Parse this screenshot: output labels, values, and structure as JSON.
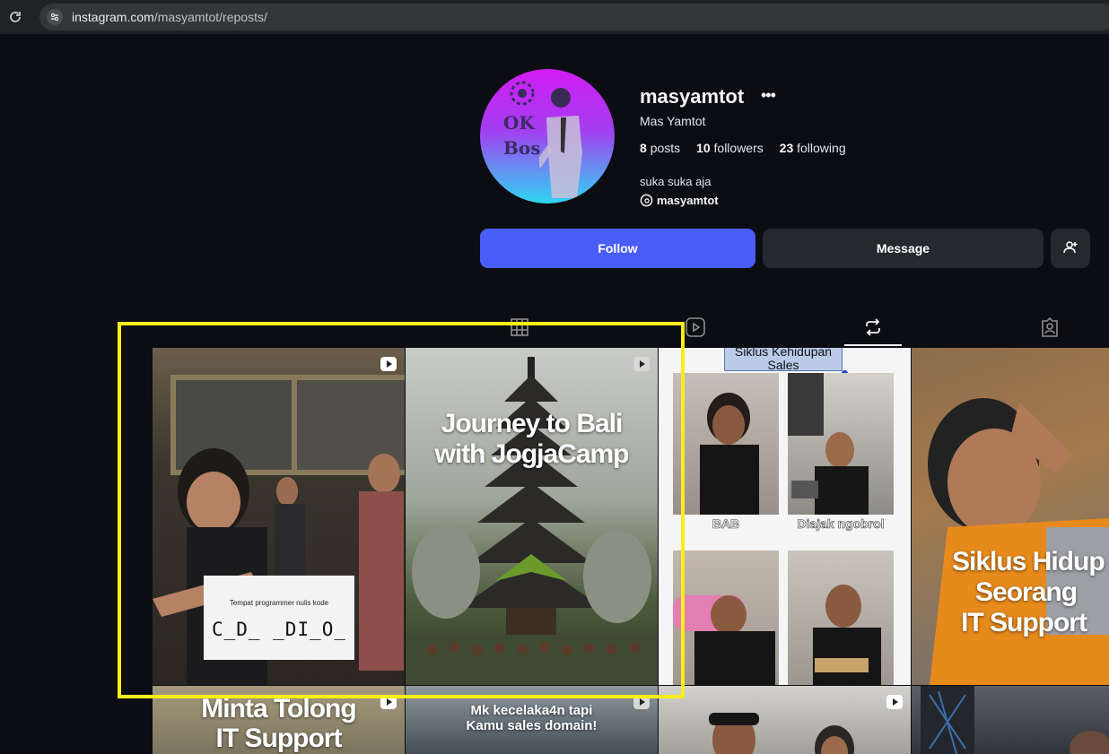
{
  "browser": {
    "url_domain": "instagram.com",
    "url_path": "/masyamtot/reposts/"
  },
  "avatar": {
    "text_line1": "OK",
    "text_line2": "Bos"
  },
  "profile": {
    "username": "masyamtot",
    "full_name": "Mas Yamtot",
    "stats": {
      "posts_count": "8",
      "posts_label": "posts",
      "followers_count": "10",
      "followers_label": "followers",
      "following_count": "23",
      "following_label": "following"
    },
    "bio": "suka suka aja",
    "threads_handle": "masyamtot"
  },
  "actions": {
    "follow_label": "Follow",
    "message_label": "Message"
  },
  "tabs": [
    "posts-grid-icon",
    "reels-icon",
    "reposts-icon",
    "tagged-icon"
  ],
  "active_tab": "reposts",
  "posts": [
    {
      "caption_small": "Tempat programmer nulis kode",
      "caption_big": "C_D_ _DI_O_"
    },
    {
      "title_line1": "Journey to Bali",
      "title_line2": "with JogjaCamp"
    },
    {
      "header": "Siklus Kehidupan Sales",
      "label_1": "BAB",
      "label_2": "Diajak ngobrol"
    },
    {
      "title_line1": "Siklus Hidup",
      "title_line2": "Seorang",
      "title_line3": "IT Support"
    },
    {
      "title_line1": "Minta Tolong",
      "title_line2": "IT Support"
    },
    {
      "title_line1": "Mk kecelaka4n tapi",
      "title_line2": "Kamu sales domain!"
    },
    {},
    {}
  ],
  "colors": {
    "background": "#0b0d12",
    "follow_button": "#4a5df9",
    "secondary_button": "#25292e",
    "highlight_box": "#f8ee1a"
  }
}
